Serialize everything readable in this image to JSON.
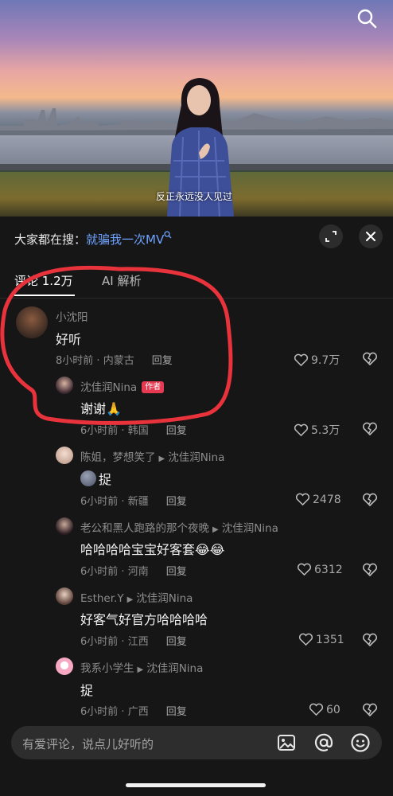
{
  "video": {
    "subtitle": "反正永远没人见过"
  },
  "search_bar": {
    "prefix": "大家都在搜：",
    "keyword": "就骗我一次MV"
  },
  "tabs": [
    {
      "label": "评论 1.2万",
      "active": true
    },
    {
      "label": "AI 解析",
      "active": false
    }
  ],
  "comments": [
    {
      "user": "小沈阳",
      "text": "好听",
      "time": "8小时前",
      "location": "内蒙古",
      "reply_label": "回复",
      "likes": "9.7万"
    },
    {
      "user": "沈佳润Nina",
      "author_badge": "作者",
      "text": "谢谢🙏",
      "time": "6小时前",
      "location": "韩国",
      "reply_label": "回复",
      "likes": "5.3万"
    },
    {
      "user": "陈姐，梦想笑了",
      "reply_to": "沈佳润Nina",
      "text": "捉",
      "time": "6小时前",
      "location": "新疆",
      "reply_label": "回复",
      "likes": "2478"
    },
    {
      "user": "老公和黑人跑路的那个夜晚",
      "reply_to": "沈佳润Nina",
      "text": "哈哈哈哈宝宝好客套😂😂",
      "time": "6小时前",
      "location": "河南",
      "reply_label": "回复",
      "likes": "6312"
    },
    {
      "user": "Esther.Y",
      "reply_to": "沈佳润Nina",
      "text": "好客气好官方哈哈哈哈",
      "time": "6小时前",
      "location": "江西",
      "reply_label": "回复",
      "likes": "1351"
    },
    {
      "user": "我系小学生",
      "reply_to": "沈佳润Nina",
      "text": "捉",
      "time": "6小时前",
      "location": "广西",
      "reply_label": "回复",
      "likes": "60"
    }
  ],
  "input": {
    "placeholder": "有爱评论，说点儿好听的"
  },
  "icons": {
    "search": "search-icon",
    "expand": "expand-icon",
    "close": "close-icon",
    "like": "heart-icon",
    "dislike": "broken-heart-icon",
    "image": "image-icon",
    "mention": "at-icon",
    "emoji": "smile-icon"
  },
  "colors": {
    "keyword": "#6fa3ff",
    "author_badge": "#e53a51",
    "annotation": "#e8333c",
    "background": "#161616"
  }
}
